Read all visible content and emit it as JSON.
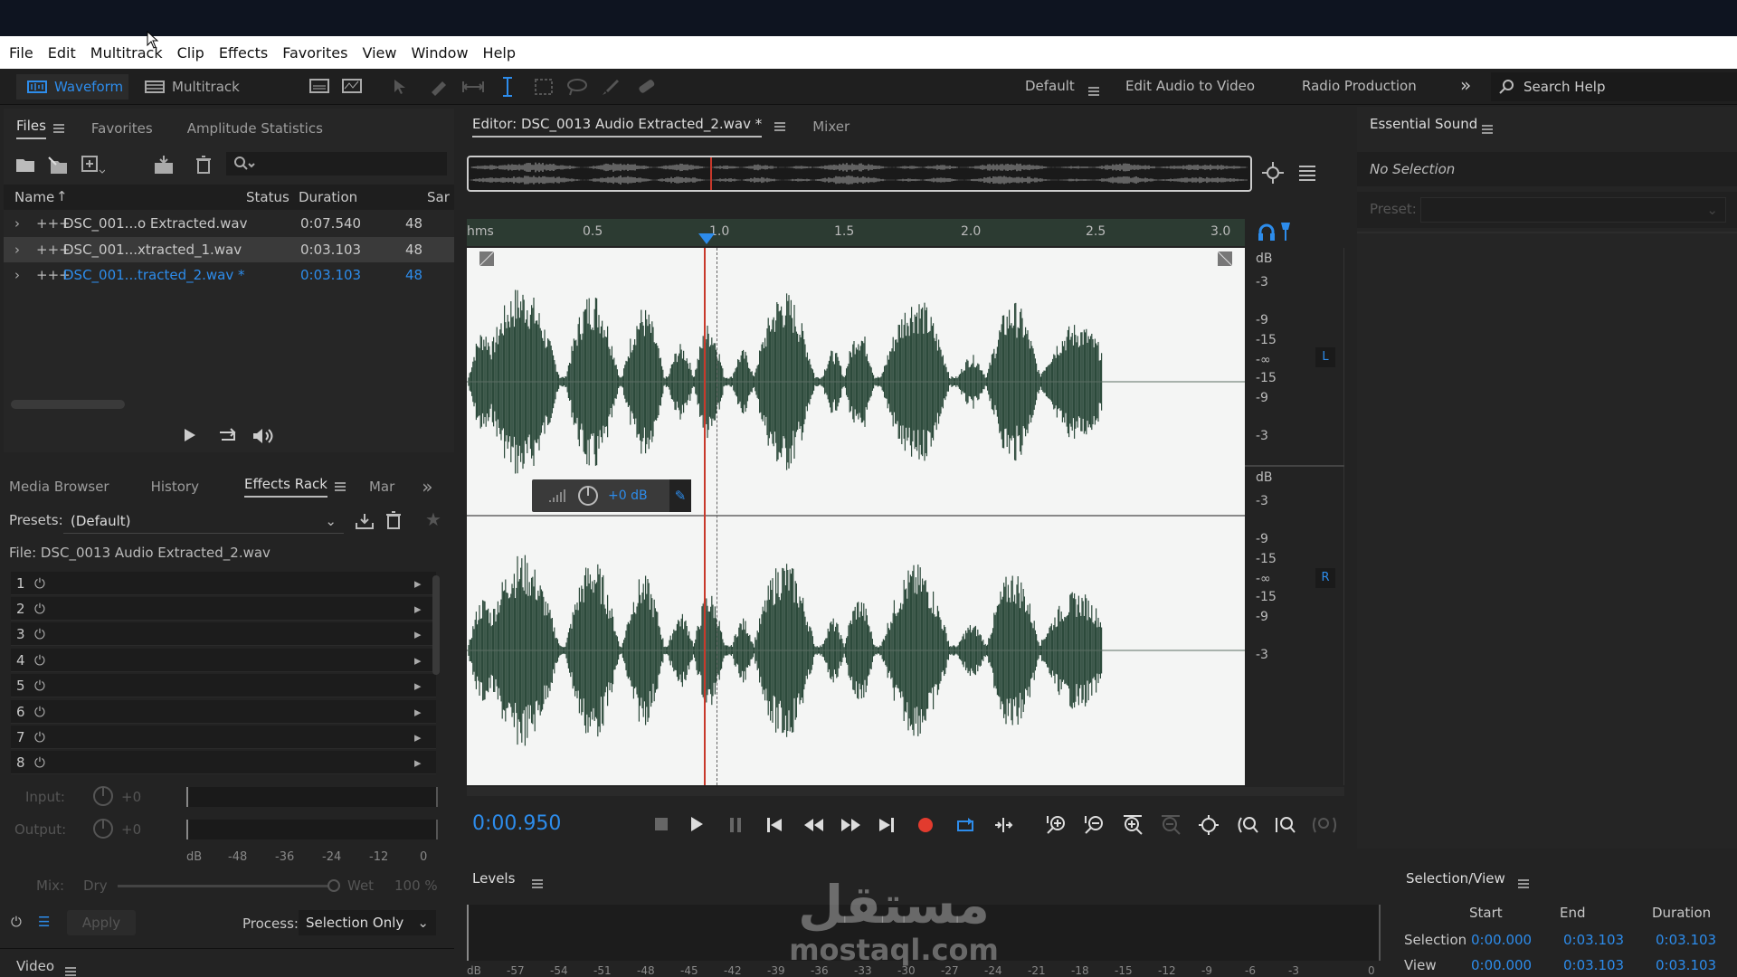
{
  "menu": [
    "File",
    "Edit",
    "Multitrack",
    "Clip",
    "Effects",
    "Favorites",
    "View",
    "Window",
    "Help"
  ],
  "toolbar": {
    "waveform_label": "Waveform",
    "multitrack_label": "Multitrack",
    "workspaces": [
      "Default",
      "Edit Audio to Video",
      "Radio Production"
    ],
    "search_placeholder": "Search Help"
  },
  "files_panel": {
    "tabs": [
      "Files",
      "Favorites",
      "Amplitude Statistics"
    ],
    "columns": [
      "Name",
      "Status",
      "Duration",
      "Sar"
    ],
    "rows": [
      {
        "name": "DSC_001...o Extracted.wav",
        "duration": "0:07.540",
        "rate": "48"
      },
      {
        "name": "DSC_001...xtracted_1.wav",
        "duration": "0:03.103",
        "rate": "48"
      },
      {
        "name": "DSC_001...tracted_2.wav *",
        "duration": "0:03.103",
        "rate": "48"
      }
    ]
  },
  "effects_panel": {
    "tabs": [
      "Media Browser",
      "History",
      "Effects Rack",
      "Mar"
    ],
    "presets_label": "Presets:",
    "presets_value": "(Default)",
    "file_label": "File: DSC_0013 Audio Extracted_2.wav",
    "slots": [
      "1",
      "2",
      "3",
      "4",
      "5",
      "6",
      "7",
      "8"
    ],
    "input_label": "Input:",
    "input_value": "+0",
    "output_label": "Output:",
    "output_value": "+0",
    "meter_ticks": [
      "dB",
      "-48",
      "-36",
      "-24",
      "-12",
      "0"
    ],
    "mix_label": "Mix:",
    "dry_label": "Dry",
    "wet_label": "Wet",
    "wet_value": "100 %",
    "apply_label": "Apply",
    "process_label": "Process:",
    "process_value": "Selection Only"
  },
  "video_panel": {
    "title": "Video"
  },
  "editor": {
    "tab_label": "Editor: DSC_0013 Audio Extracted_2.wav *",
    "mixer_label": "Mixer",
    "ruler": [
      "hms",
      "0.5",
      "1.0",
      "1.5",
      "2.0",
      "2.5",
      "3.0"
    ],
    "db_scale_top": [
      "dB",
      "-3",
      "-9",
      "-15",
      "-∞",
      "-15",
      "-9",
      "-3"
    ],
    "db_scale_bottom": [
      "dB",
      "-3",
      "-9",
      "-15",
      "-∞",
      "-15",
      "-9",
      "-3"
    ],
    "channel_left": "L",
    "channel_right": "R",
    "hud_gain": "+0 dB",
    "time": "0:00.950",
    "colors": {
      "waveform": "#2c4a3b",
      "background": "#f4f5f4",
      "playhead": "#c8392b",
      "accent": "#2d8ceb"
    }
  },
  "essential_sound": {
    "title": "Essential Sound",
    "no_selection": "No Selection",
    "preset_label": "Preset:"
  },
  "levels": {
    "title": "Levels",
    "ticks": [
      "dB",
      "-57",
      "-54",
      "-51",
      "-48",
      "-45",
      "-42",
      "-39",
      "-36",
      "-33",
      "-30",
      "-27",
      "-24",
      "-21",
      "-18",
      "-15",
      "-12",
      "-9",
      "-6",
      "-3",
      "0"
    ]
  },
  "selection_view": {
    "title": "Selection/View",
    "columns": [
      "Start",
      "End",
      "Duration"
    ],
    "rows": [
      {
        "label": "Selection",
        "start": "0:00.000",
        "end": "0:03.103",
        "duration": "0:03.103"
      },
      {
        "label": "View",
        "start": "0:00.000",
        "end": "0:03.103",
        "duration": "0:03.103"
      }
    ]
  },
  "watermark": {
    "arabic": "مستقل",
    "latin": "mostaql.com"
  }
}
